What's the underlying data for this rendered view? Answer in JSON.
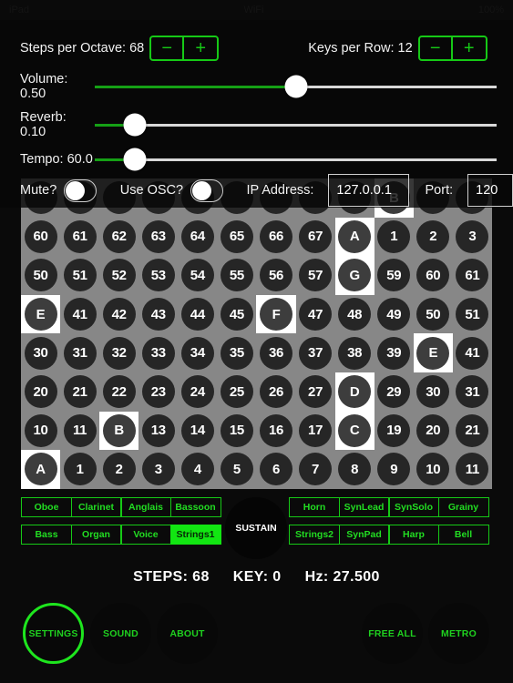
{
  "statusbar": {
    "left": "iPad",
    "mid": "WiFi",
    "right": "100%"
  },
  "settings": {
    "steps_per_octave": {
      "label": "Steps per Octave: 68",
      "minus": "−",
      "plus": "+"
    },
    "keys_per_row": {
      "label": "Keys per Row: 12",
      "minus": "−",
      "plus": "+"
    },
    "sliders": [
      {
        "label": "Volume: 0.50",
        "value": 0.5,
        "percent": 50
      },
      {
        "label": "Reverb: 0.10",
        "value": 0.1,
        "percent": 10
      },
      {
        "label": "Tempo: 60.0",
        "value": 60.0,
        "percent": 10
      }
    ],
    "mute": {
      "label": "Mute?",
      "on": false
    },
    "use_osc": {
      "label": "Use OSC?",
      "on": false
    },
    "ip": {
      "label": "IP Address:",
      "value": "127.0.0.1",
      "placeholder": "127.0.0.1"
    },
    "port": {
      "label": "Port:",
      "value": "120",
      "placeholder": "Port"
    }
  },
  "grid": {
    "rows": [
      [
        {
          "t": "",
          "hl": false
        },
        {
          "t": "",
          "hl": false
        },
        {
          "t": "",
          "hl": false
        },
        {
          "t": "",
          "hl": false
        },
        {
          "t": "",
          "hl": false
        },
        {
          "t": "",
          "hl": false
        },
        {
          "t": "",
          "hl": false
        },
        {
          "t": "",
          "hl": false
        },
        {
          "t": "",
          "hl": false
        },
        {
          "t": "B",
          "hl": true
        },
        {
          "t": "",
          "hl": false
        },
        {
          "t": "",
          "hl": false
        }
      ],
      [
        {
          "t": "60",
          "hl": false
        },
        {
          "t": "61",
          "hl": false
        },
        {
          "t": "62",
          "hl": false
        },
        {
          "t": "63",
          "hl": false
        },
        {
          "t": "64",
          "hl": false
        },
        {
          "t": "65",
          "hl": false
        },
        {
          "t": "66",
          "hl": false
        },
        {
          "t": "67",
          "hl": false
        },
        {
          "t": "A",
          "hl": true
        },
        {
          "t": "1",
          "hl": false
        },
        {
          "t": "2",
          "hl": false
        },
        {
          "t": "3",
          "hl": false
        }
      ],
      [
        {
          "t": "50",
          "hl": false
        },
        {
          "t": "51",
          "hl": false
        },
        {
          "t": "52",
          "hl": false
        },
        {
          "t": "53",
          "hl": false
        },
        {
          "t": "54",
          "hl": false
        },
        {
          "t": "55",
          "hl": false
        },
        {
          "t": "56",
          "hl": false
        },
        {
          "t": "57",
          "hl": false
        },
        {
          "t": "G",
          "hl": true
        },
        {
          "t": "59",
          "hl": false
        },
        {
          "t": "60",
          "hl": false
        },
        {
          "t": "61",
          "hl": false
        }
      ],
      [
        {
          "t": "E",
          "hl": true
        },
        {
          "t": "41",
          "hl": false
        },
        {
          "t": "42",
          "hl": false
        },
        {
          "t": "43",
          "hl": false
        },
        {
          "t": "44",
          "hl": false
        },
        {
          "t": "45",
          "hl": false
        },
        {
          "t": "F",
          "hl": true
        },
        {
          "t": "47",
          "hl": false
        },
        {
          "t": "48",
          "hl": false
        },
        {
          "t": "49",
          "hl": false
        },
        {
          "t": "50",
          "hl": false
        },
        {
          "t": "51",
          "hl": false
        }
      ],
      [
        {
          "t": "30",
          "hl": false
        },
        {
          "t": "31",
          "hl": false
        },
        {
          "t": "32",
          "hl": false
        },
        {
          "t": "33",
          "hl": false
        },
        {
          "t": "34",
          "hl": false
        },
        {
          "t": "35",
          "hl": false
        },
        {
          "t": "36",
          "hl": false
        },
        {
          "t": "37",
          "hl": false
        },
        {
          "t": "38",
          "hl": false
        },
        {
          "t": "39",
          "hl": false
        },
        {
          "t": "E",
          "hl": true
        },
        {
          "t": "41",
          "hl": false
        }
      ],
      [
        {
          "t": "20",
          "hl": false
        },
        {
          "t": "21",
          "hl": false
        },
        {
          "t": "22",
          "hl": false
        },
        {
          "t": "23",
          "hl": false
        },
        {
          "t": "24",
          "hl": false
        },
        {
          "t": "25",
          "hl": false
        },
        {
          "t": "26",
          "hl": false
        },
        {
          "t": "27",
          "hl": false
        },
        {
          "t": "D",
          "hl": true
        },
        {
          "t": "29",
          "hl": false
        },
        {
          "t": "30",
          "hl": false
        },
        {
          "t": "31",
          "hl": false
        }
      ],
      [
        {
          "t": "10",
          "hl": false
        },
        {
          "t": "11",
          "hl": false
        },
        {
          "t": "B",
          "hl": true
        },
        {
          "t": "13",
          "hl": false
        },
        {
          "t": "14",
          "hl": false
        },
        {
          "t": "15",
          "hl": false
        },
        {
          "t": "16",
          "hl": false
        },
        {
          "t": "17",
          "hl": false
        },
        {
          "t": "C",
          "hl": true
        },
        {
          "t": "19",
          "hl": false
        },
        {
          "t": "20",
          "hl": false
        },
        {
          "t": "21",
          "hl": false
        }
      ],
      [
        {
          "t": "A",
          "hl": true
        },
        {
          "t": "1",
          "hl": false
        },
        {
          "t": "2",
          "hl": false
        },
        {
          "t": "3",
          "hl": false
        },
        {
          "t": "4",
          "hl": false
        },
        {
          "t": "5",
          "hl": false
        },
        {
          "t": "6",
          "hl": false
        },
        {
          "t": "7",
          "hl": false
        },
        {
          "t": "8",
          "hl": false
        },
        {
          "t": "9",
          "hl": false
        },
        {
          "t": "10",
          "hl": false
        },
        {
          "t": "11",
          "hl": false
        }
      ]
    ]
  },
  "instruments": {
    "left_row1": [
      {
        "label": "Oboe",
        "on": false
      },
      {
        "label": "Clarinet",
        "on": false
      },
      {
        "label": "Anglais",
        "on": false
      },
      {
        "label": "Bassoon",
        "on": false
      }
    ],
    "left_row2": [
      {
        "label": "Bass",
        "on": false
      },
      {
        "label": "Organ",
        "on": false
      },
      {
        "label": "Voice",
        "on": false
      },
      {
        "label": "Strings1",
        "on": true
      }
    ],
    "right_row1": [
      {
        "label": "Horn",
        "on": false
      },
      {
        "label": "SynLead",
        "on": false
      },
      {
        "label": "SynSolo",
        "on": false
      },
      {
        "label": "Grainy",
        "on": false
      }
    ],
    "right_row2": [
      {
        "label": "Strings2",
        "on": false
      },
      {
        "label": "SynPad",
        "on": false
      },
      {
        "label": "Harp",
        "on": false
      },
      {
        "label": "Bell",
        "on": false
      }
    ],
    "sustain": "SUSTAIN"
  },
  "status": {
    "steps": "STEPS: 68",
    "key": "KEY: 0",
    "hz": "Hz: 27.500"
  },
  "bottom_buttons": [
    {
      "label": "SETTINGS",
      "selected": true
    },
    {
      "label": "SOUND",
      "selected": false
    },
    {
      "label": "ABOUT",
      "selected": false
    },
    {
      "label": "FREE ALL",
      "selected": false
    },
    {
      "label": "METRO",
      "selected": false
    }
  ],
  "colors": {
    "accent_green": "#16c916",
    "active_green": "#12e612",
    "grid_bg": "#878787",
    "disc": "#262626"
  }
}
